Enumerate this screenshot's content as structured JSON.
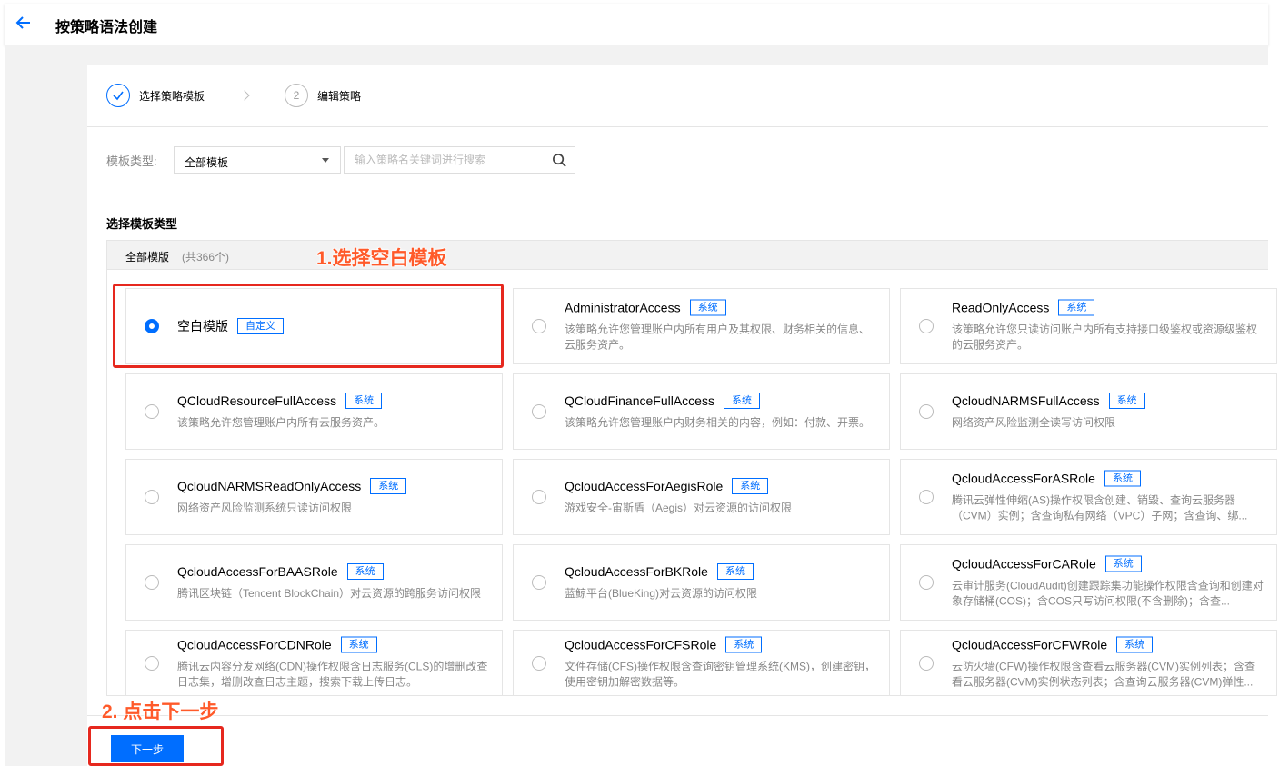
{
  "header": {
    "title": "按策略语法创建"
  },
  "steps": [
    {
      "label": "选择策略模板",
      "done": true
    },
    {
      "number": "2",
      "label": "编辑策略",
      "done": false
    }
  ],
  "filter": {
    "label": "模板类型:",
    "select_value": "全部模板",
    "search_placeholder": "输入策略名关键词进行搜索"
  },
  "section_title": "选择模板类型",
  "list": {
    "all_label": "全部模版",
    "count": "(共366个)"
  },
  "templates": [
    {
      "name": "空白模版",
      "tag": "自定义",
      "desc": "",
      "selected": true
    },
    {
      "name": "AdministratorAccess",
      "tag": "系统",
      "desc": "该策略允许您管理账户内所有用户及其权限、财务相关的信息、云服务资产。",
      "selected": false
    },
    {
      "name": "ReadOnlyAccess",
      "tag": "系统",
      "desc": "该策略允许您只读访问账户内所有支持接口级鉴权或资源级鉴权的云服务资产。",
      "selected": false
    },
    {
      "name": "QCloudResourceFullAccess",
      "tag": "系统",
      "desc": "该策略允许您管理账户内所有云服务资产。",
      "selected": false
    },
    {
      "name": "QCloudFinanceFullAccess",
      "tag": "系统",
      "desc": "该策略允许您管理账户内财务相关的内容，例如：付款、开票。",
      "selected": false
    },
    {
      "name": "QcloudNARMSFullAccess",
      "tag": "系统",
      "desc": "网络资产风险监测全读写访问权限",
      "selected": false
    },
    {
      "name": "QcloudNARMSReadOnlyAccess",
      "tag": "系统",
      "desc": "网络资产风险监测系统只读访问权限",
      "selected": false
    },
    {
      "name": "QcloudAccessForAegisRole",
      "tag": "系统",
      "desc": "游戏安全-宙斯盾（Aegis）对云资源的访问权限",
      "selected": false
    },
    {
      "name": "QcloudAccessForASRole",
      "tag": "系统",
      "desc": "腾讯云弹性伸缩(AS)操作权限含创建、销毁、查询云服务器（CVM）实例；含查询私有网络（VPC）子网；含查询、绑...",
      "selected": false
    },
    {
      "name": "QcloudAccessForBAASRole",
      "tag": "系统",
      "desc": "腾讯区块链（Tencent BlockChain）对云资源的跨服务访问权限",
      "selected": false
    },
    {
      "name": "QcloudAccessForBKRole",
      "tag": "系统",
      "desc": "蓝鲸平台(BlueKing)对云资源的访问权限",
      "selected": false
    },
    {
      "name": "QcloudAccessForCARole",
      "tag": "系统",
      "desc": "云审计服务(CloudAudit)创建跟踪集功能操作权限含查询和创建对象存储桶(COS)；含COS只写访问权限(不含删除)；含查...",
      "selected": false
    },
    {
      "name": "QcloudAccessForCDNRole",
      "tag": "系统",
      "desc": "腾讯云内容分发网络(CDN)操作权限含日志服务(CLS)的增删改查日志集，增删改查日志主题，搜索下载上传日志。",
      "selected": false
    },
    {
      "name": "QcloudAccessForCFSRole",
      "tag": "系统",
      "desc": "文件存储(CFS)操作权限含查询密钥管理系统(KMS)，创建密钥，使用密钥加解密数据等。",
      "selected": false
    },
    {
      "name": "QcloudAccessForCFWRole",
      "tag": "系统",
      "desc": "云防火墙(CFW)操作权限含查看云服务器(CVM)实例列表；含查看云服务器(CVM)实例状态列表；含查询云服务器(CVM)弹性...",
      "selected": false
    }
  ],
  "annotations": {
    "step1": "1.选择空白模板",
    "step2": "2. 点击下一步"
  },
  "footer": {
    "next_label": "下一步"
  },
  "colors": {
    "accent": "#006eff",
    "annotation_red": "#e6281e",
    "annotation_text": "#ff5a2a"
  }
}
